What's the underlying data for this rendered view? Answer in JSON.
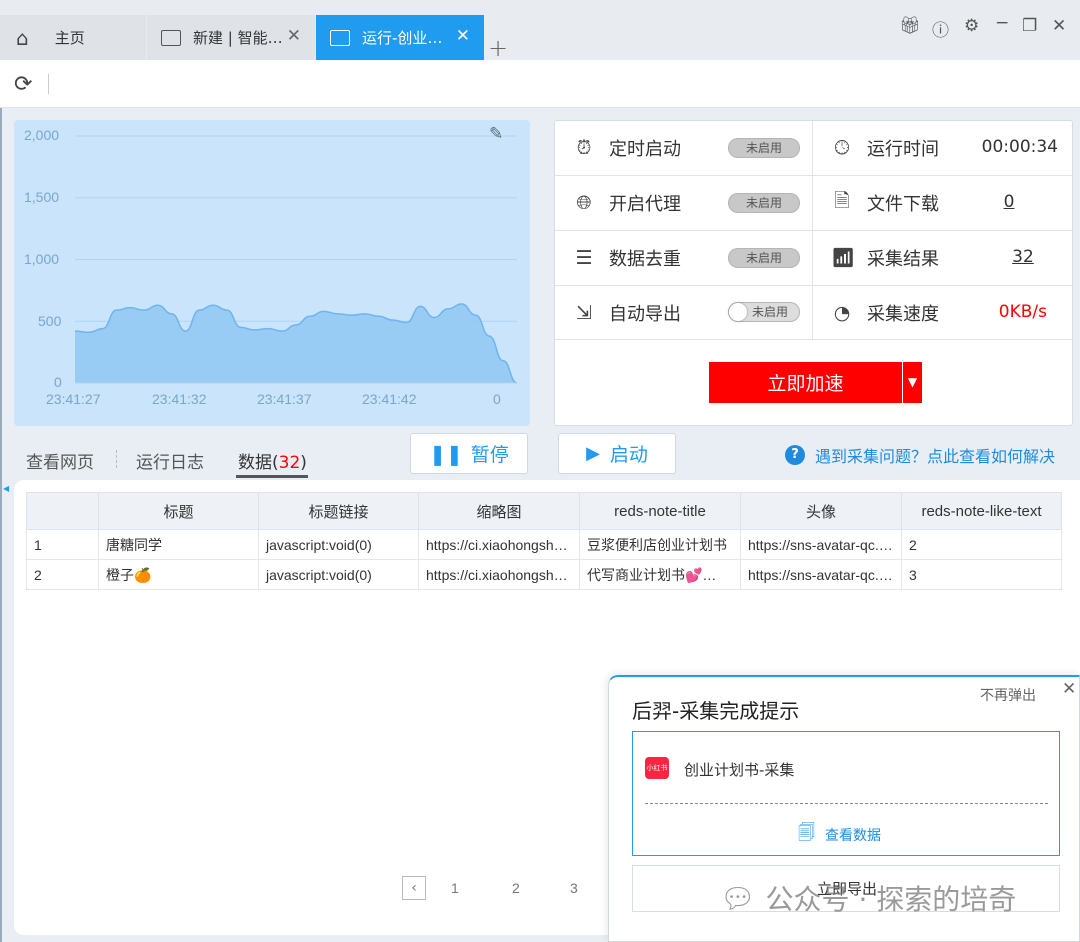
{
  "tabs": {
    "home_label": "主页",
    "new_label": "新建 | 智能…",
    "run_label": "运行-创业…",
    "close_glyph": "✕",
    "add_glyph": "+"
  },
  "chart_data": {
    "type": "area",
    "y_ticks": [
      "2,000",
      "1,500",
      "1,000",
      "500",
      "0"
    ],
    "x_ticks": [
      "23:41:27",
      "23:41:32",
      "23:41:37",
      "23:41:42",
      "0"
    ],
    "ylim": [
      0,
      2000
    ],
    "grid": true,
    "color": "#90c8f3",
    "values": [
      420,
      410,
      440,
      590,
      610,
      590,
      630,
      560,
      420,
      590,
      630,
      590,
      450,
      430,
      440,
      420,
      470,
      540,
      580,
      560,
      550,
      560,
      540,
      510,
      490,
      620,
      530,
      600,
      640,
      550,
      380,
      180,
      0
    ]
  },
  "info": {
    "schedule_label": "定时启动",
    "schedule_status": "未启用",
    "proxy_label": "开启代理",
    "proxy_status": "未启用",
    "dedupe_label": "数据去重",
    "dedupe_status": "未启用",
    "export_label": "自动导出",
    "export_status": "未启用",
    "runtime_label": "运行时间",
    "runtime_value": "00:00:34",
    "download_label": "文件下载",
    "download_value": "0",
    "result_label": "采集结果",
    "result_value": "32",
    "speed_label": "采集速度",
    "speed_value": "0KB/s",
    "accelerate_label": "立即加速"
  },
  "view_tabs": {
    "webpage": "查看网页",
    "log": "运行日志",
    "data": "数据",
    "data_count": "32"
  },
  "buttons": {
    "pause": "暂停",
    "start": "启动"
  },
  "help_text": "遇到采集问题？点此查看如何解决",
  "table": {
    "headers": [
      "",
      "标题",
      "标题链接",
      "缩略图",
      "reds-note-title",
      "头像",
      "reds-note-like-text"
    ],
    "rows": [
      [
        "1",
        "唐糖同学",
        "javascript:void(0)",
        "https://ci.xiaohongsh…",
        "豆浆便利店创业计划书",
        "https://sns-avatar-qc.…",
        "2"
      ],
      [
        "2",
        "橙子🍊",
        "javascript:void(0)",
        "https://ci.xiaohongsh…",
        "代写商业计划书💕…",
        "https://sns-avatar-qc.…",
        "3"
      ]
    ]
  },
  "pagination": [
    "1",
    "2",
    "3"
  ],
  "popup": {
    "title": "后羿-采集完成提示",
    "dismiss": "不再弹出",
    "app_badge": "小红书",
    "task_name": "创业计划书-采集",
    "view_data": "查看数据",
    "export_now": "立即导出"
  },
  "watermark": "公众号 · 探索的培奇"
}
